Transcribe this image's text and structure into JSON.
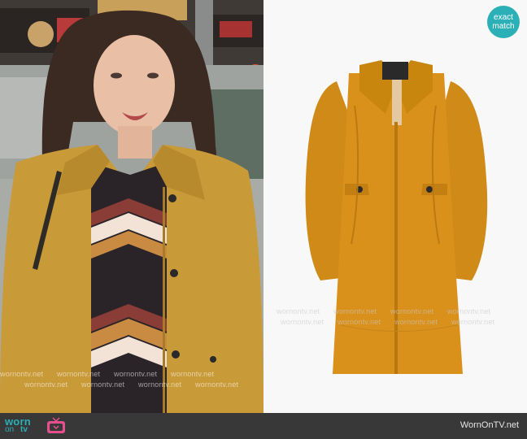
{
  "badge": {
    "line1": "exact",
    "line2": "match"
  },
  "watermark": {
    "text": "wornontv.net"
  },
  "footer": {
    "logo_worn": "worn",
    "logo_on": "on",
    "logo_tv": "tv",
    "site_name": "WornOnTV.net"
  },
  "icons": [
    "tv-icon"
  ],
  "colors": {
    "brand_teal": "#2bb0b7",
    "footer_bg": "#383838",
    "coat_mustard": "#d4901a"
  }
}
